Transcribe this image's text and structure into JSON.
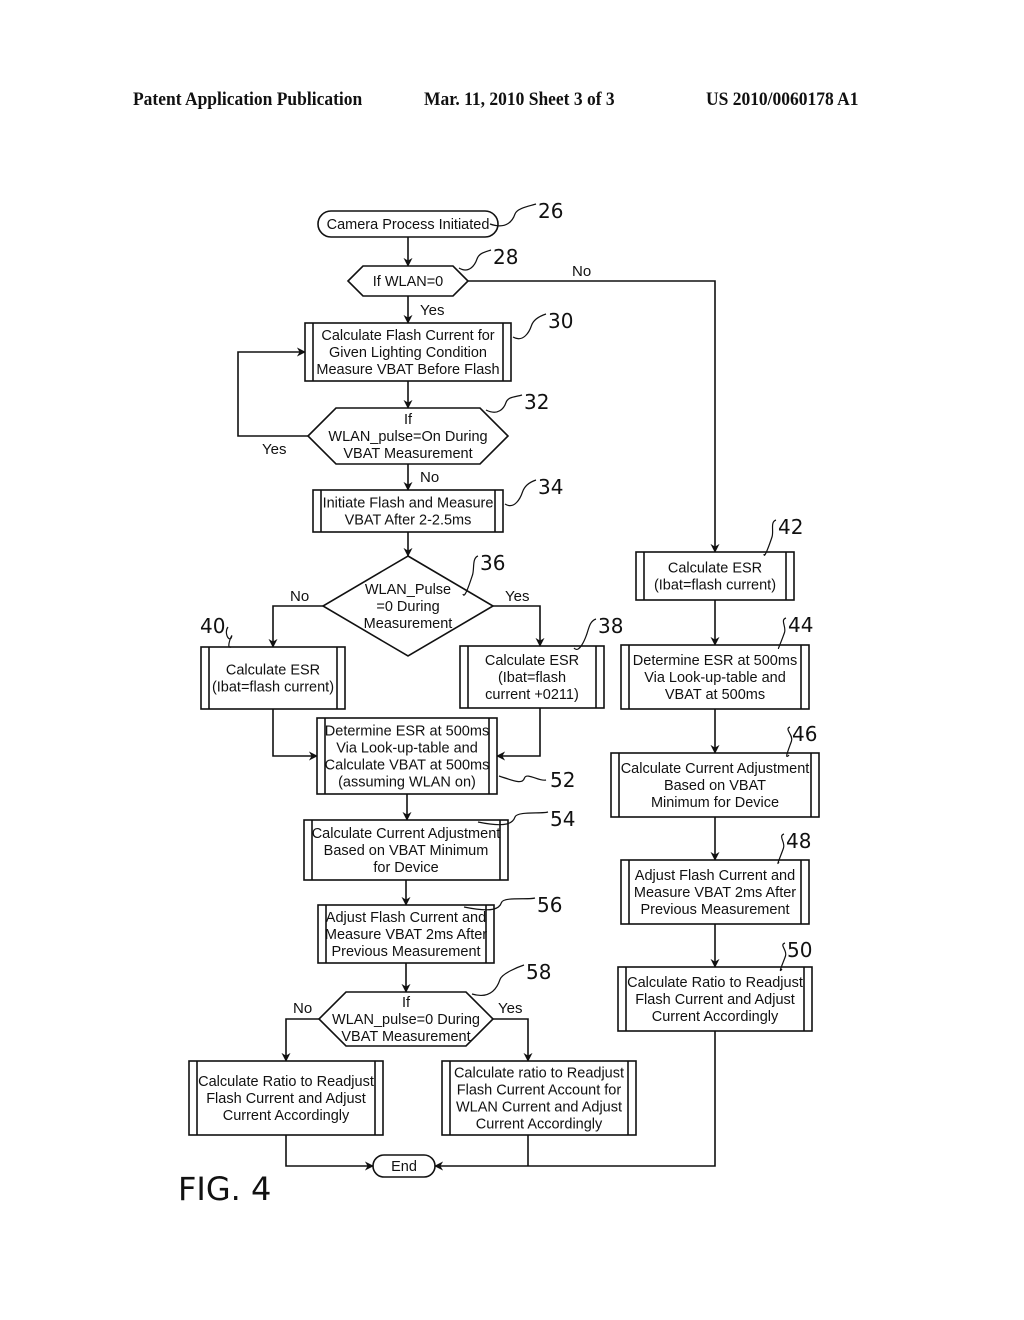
{
  "header": {
    "left": "Patent Application Publication",
    "middle": "Mar. 11, 2010  Sheet 3 of 3",
    "right": "US 2010/0060178 A1"
  },
  "figure_label": "FIG. 4",
  "nodes": {
    "n26": {
      "ref": "26",
      "type": "terminator",
      "lines": [
        "Camera Process Initiated"
      ]
    },
    "n28": {
      "ref": "28",
      "type": "decision",
      "lines": [
        "If WLAN=0"
      ]
    },
    "n30": {
      "ref": "30",
      "type": "process",
      "lines": [
        "Calculate Flash Current for",
        "Given Lighting Condition",
        "Measure VBAT Before Flash"
      ]
    },
    "n32": {
      "ref": "32",
      "type": "decision",
      "lines": [
        "If",
        "WLAN_pulse=On During",
        "VBAT Measurement"
      ]
    },
    "n34": {
      "ref": "34",
      "type": "process",
      "lines": [
        "Initiate Flash and Measure",
        "VBAT After 2-2.5ms"
      ]
    },
    "n36": {
      "ref": "36",
      "type": "decision",
      "lines": [
        "WLAN_Pulse",
        "=0 During",
        "Measurement"
      ]
    },
    "n38": {
      "ref": "38",
      "type": "process",
      "lines": [
        "Calculate ESR",
        "(Ibat=flash",
        "current +0211)"
      ]
    },
    "n40": {
      "ref": "40",
      "type": "process",
      "lines": [
        "Calculate ESR",
        "(Ibat=flash current)"
      ]
    },
    "n52": {
      "ref": "52",
      "type": "process",
      "lines": [
        "Determine ESR at 500ms",
        "Via Look-up-table and",
        "Calculate VBAT at 500ms",
        "(assuming WLAN on)"
      ]
    },
    "n54": {
      "ref": "54",
      "type": "process",
      "lines": [
        "Calculate Current Adjustment",
        "Based on VBAT Minimum",
        "for Device"
      ]
    },
    "n56": {
      "ref": "56",
      "type": "process",
      "lines": [
        "Adjust Flash Current and",
        "Measure VBAT 2ms After",
        "Previous Measurement"
      ]
    },
    "n58": {
      "ref": "58",
      "type": "decision",
      "lines": [
        "If",
        "WLAN_pulse=0 During",
        "VBAT Measurement"
      ]
    },
    "nL": {
      "ref": "",
      "type": "process",
      "lines": [
        "Calculate Ratio to Readjust",
        "Flash Current and Adjust",
        "Current Accordingly"
      ]
    },
    "nR": {
      "ref": "",
      "type": "process",
      "lines": [
        "Calculate ratio to Readjust",
        "Flash Current Account for",
        "WLAN Current and Adjust",
        "Current Accordingly"
      ]
    },
    "n42": {
      "ref": "42",
      "type": "process",
      "lines": [
        "Calculate ESR",
        "(Ibat=flash current)"
      ]
    },
    "n44": {
      "ref": "44",
      "type": "process",
      "lines": [
        "Determine ESR at 500ms",
        "Via Look-up-table and",
        "VBAT at 500ms"
      ]
    },
    "n46": {
      "ref": "46",
      "type": "process",
      "lines": [
        "Calculate Current Adjustment",
        "Based on VBAT",
        "Minimum for Device"
      ]
    },
    "n48": {
      "ref": "48",
      "type": "process",
      "lines": [
        "Adjust Flash Current and",
        "Measure VBAT 2ms After",
        "Previous Measurement"
      ]
    },
    "n50": {
      "ref": "50",
      "type": "process",
      "lines": [
        "Calculate Ratio to Readjust",
        "Flash Current and Adjust",
        "Current Accordingly"
      ]
    },
    "end": {
      "ref": "",
      "type": "terminator",
      "lines": [
        "End"
      ]
    }
  },
  "edge_labels": {
    "n28_no": "No",
    "n28_yes": "Yes",
    "n32_yes": "Yes",
    "n32_no": "No",
    "n36_no": "No",
    "n36_yes": "Yes",
    "n58_no": "No",
    "n58_yes": "Yes"
  }
}
